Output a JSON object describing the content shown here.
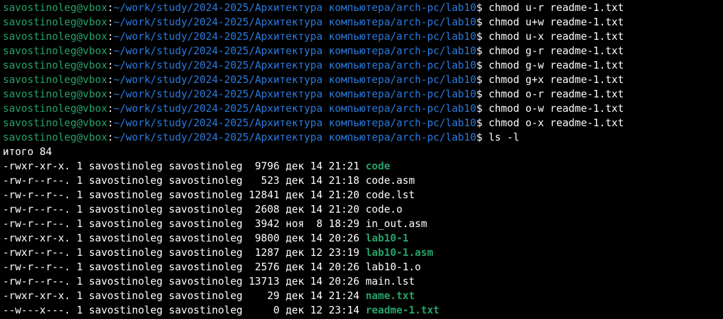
{
  "prompt": {
    "user_host": "savostinoleg@vbox",
    "colon": ":",
    "path": "~/work/study/2024-2025/Архитектура компьютера/arch-pc/lab10",
    "symbol": "$ "
  },
  "commands": [
    "chmod u-r readme-1.txt",
    "chmod u+w readme-1.txt",
    "chmod u-x readme-1.txt",
    "chmod g-r readme-1.txt",
    "chmod g-w readme-1.txt",
    "chmod g+x readme-1.txt",
    "chmod o-r readme-1.txt",
    "chmod o-w readme-1.txt",
    "chmod o-x readme-1.txt",
    "ls -l"
  ],
  "total_line": "итого 84",
  "listing": [
    {
      "meta": "-rwxr-xr-x. 1 savostinoleg savostinoleg  9796 дек 14 21:21 ",
      "name": "code",
      "exec": true
    },
    {
      "meta": "-rw-r--r--. 1 savostinoleg savostinoleg   523 дек 14 21:18 ",
      "name": "code.asm",
      "exec": false
    },
    {
      "meta": "-rw-r--r--. 1 savostinoleg savostinoleg 12841 дек 14 21:20 ",
      "name": "code.lst",
      "exec": false
    },
    {
      "meta": "-rw-r--r--. 1 savostinoleg savostinoleg  2608 дек 14 21:20 ",
      "name": "code.o",
      "exec": false
    },
    {
      "meta": "-rw-r--r--. 1 savostinoleg savostinoleg  3942 ноя  8 18:29 ",
      "name": "in_out.asm",
      "exec": false
    },
    {
      "meta": "-rwxr-xr-x. 1 savostinoleg savostinoleg  9800 дек 14 20:26 ",
      "name": "lab10-1",
      "exec": true
    },
    {
      "meta": "-rwxr--r--. 1 savostinoleg savostinoleg  1287 дек 12 23:19 ",
      "name": "lab10-1.asm",
      "exec": true
    },
    {
      "meta": "-rw-r--r--. 1 savostinoleg savostinoleg  2576 дек 14 20:26 ",
      "name": "lab10-1.o",
      "exec": false
    },
    {
      "meta": "-rw-r--r--. 1 savostinoleg savostinoleg 13713 дек 14 20:26 ",
      "name": "main.lst",
      "exec": false
    },
    {
      "meta": "-rwxr-xr-x. 1 savostinoleg savostinoleg    29 дек 14 21:24 ",
      "name": "name.txt",
      "exec": true
    },
    {
      "meta": "--w---x---. 1 savostinoleg savostinoleg     0 дек 12 23:14 ",
      "name": "readme-1.txt",
      "exec": true
    }
  ],
  "colors": {
    "background": "#000000",
    "user_host": "#26a269",
    "path": "#2a7bde",
    "text": "#ffffff",
    "executable": "#26a269"
  }
}
